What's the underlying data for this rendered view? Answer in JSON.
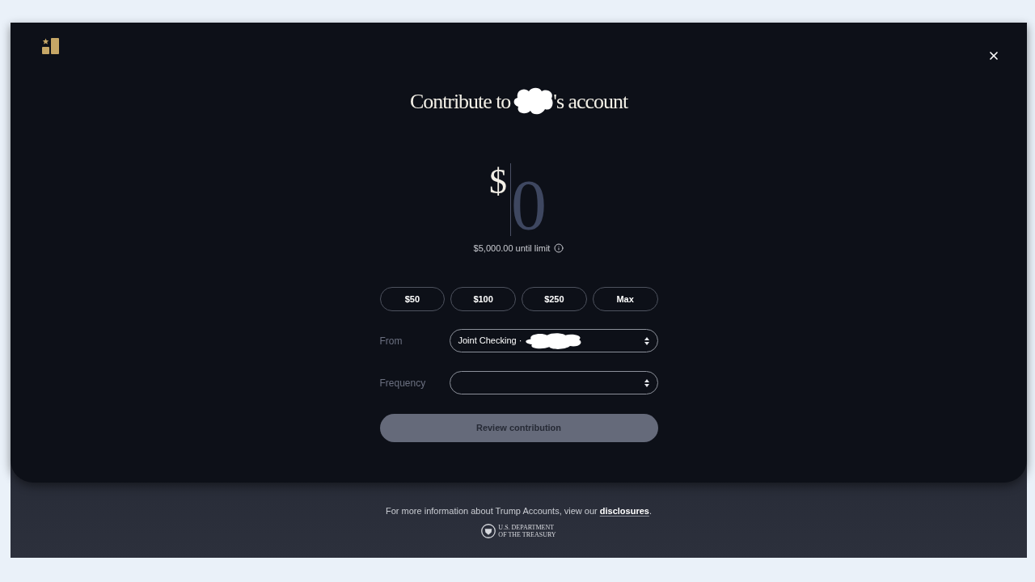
{
  "title": {
    "prefix": "Contribute to",
    "name_redacted": true,
    "suffix": "'s account"
  },
  "amount": {
    "currency": "$",
    "placeholder": "0"
  },
  "limit_note": "$5,000.00 until limit",
  "presets": [
    "$50",
    "$100",
    "$250",
    "Max"
  ],
  "fields": [
    {
      "label": "From",
      "value": "Joint Checking ·",
      "value_redacted": true
    },
    {
      "label": "Frequency"
    }
  ],
  "submit": {
    "label": "Review contribution",
    "disabled": true
  },
  "footer": {
    "text": "For more information about Trump Accounts, view our",
    "link": "disclosures",
    "after_link": ".",
    "seal_text": [
      "U.S. DEPARTMENT",
      "OF THE TREASURY"
    ]
  }
}
